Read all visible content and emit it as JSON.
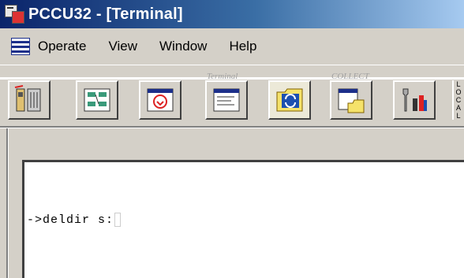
{
  "window": {
    "title": "PCCU32 - [Terminal]"
  },
  "menu": {
    "items": [
      "Operate",
      "View",
      "Window",
      "Help"
    ]
  },
  "toolbar": {
    "buttons": [
      {
        "icon": "trash-device-icon",
        "tooltip": ""
      },
      {
        "icon": "board-config-icon",
        "tooltip": ""
      },
      {
        "icon": "download-icon",
        "tooltip": ""
      },
      {
        "icon": "terminal-icon",
        "tooltip": "Terminal"
      },
      {
        "icon": "refresh-icon",
        "tooltip": ""
      },
      {
        "icon": "collect-icon",
        "tooltip": "COLLECT"
      },
      {
        "icon": "tools-icon",
        "tooltip": ""
      }
    ],
    "terminal_text": "Terminal",
    "collect_text": "COLLECT",
    "side_label": "L O C A L"
  },
  "terminal": {
    "prompt": "->deldir s:"
  },
  "colors": {
    "titlebar_start": "#0a246a",
    "titlebar_end": "#a6caf0",
    "face": "#d4d0c8"
  }
}
